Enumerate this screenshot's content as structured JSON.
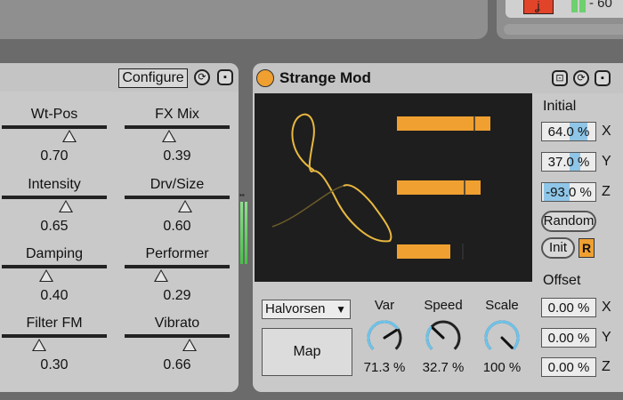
{
  "top": {
    "red_button_glyph": "ʝ",
    "db_label": "- 60"
  },
  "left_device": {
    "configure_label": "Configure",
    "params": [
      {
        "name": "Wt-Pos",
        "value": "0.70",
        "level": 0.7
      },
      {
        "name": "FX Mix",
        "value": "0.39",
        "level": 0.39
      },
      {
        "name": "Intensity",
        "value": "0.65",
        "level": 0.65
      },
      {
        "name": "Drv/Size",
        "value": "0.60",
        "level": 0.6
      },
      {
        "name": "Damping",
        "value": "0.40",
        "level": 0.4
      },
      {
        "name": "Performer",
        "value": "0.29",
        "level": 0.29
      },
      {
        "name": "Filter FM",
        "value": "0.30",
        "level": 0.3
      },
      {
        "name": "Vibrato",
        "value": "0.66",
        "level": 0.66
      }
    ]
  },
  "mod_device": {
    "title": "Strange Mod",
    "initial_label": "Initial",
    "offset_label": "Offset",
    "initial": [
      {
        "value": "64.0 %",
        "axis": "X"
      },
      {
        "value": "37.0 %",
        "axis": "Y"
      },
      {
        "value": "-93.0 %",
        "axis": "Z"
      }
    ],
    "offset": [
      {
        "value": "0.00 %",
        "axis": "X"
      },
      {
        "value": "0.00 %",
        "axis": "Y"
      },
      {
        "value": "0.00 %",
        "axis": "Z"
      }
    ],
    "random_label": "Random",
    "init_label": "Init",
    "r_label": "R",
    "attractor": "Halvorsen",
    "map_label": "Map",
    "knobs": [
      {
        "name": "Var",
        "value": "71.3 %",
        "level": 0.713
      },
      {
        "name": "Speed",
        "value": "32.7 %",
        "level": 0.327
      },
      {
        "name": "Scale",
        "value": "100 %",
        "level": 1.0
      }
    ],
    "bars_levels": [
      0.78,
      0.7,
      0.45
    ],
    "accent_color": "#f0a030",
    "knob_color": "#6ec3ea"
  }
}
